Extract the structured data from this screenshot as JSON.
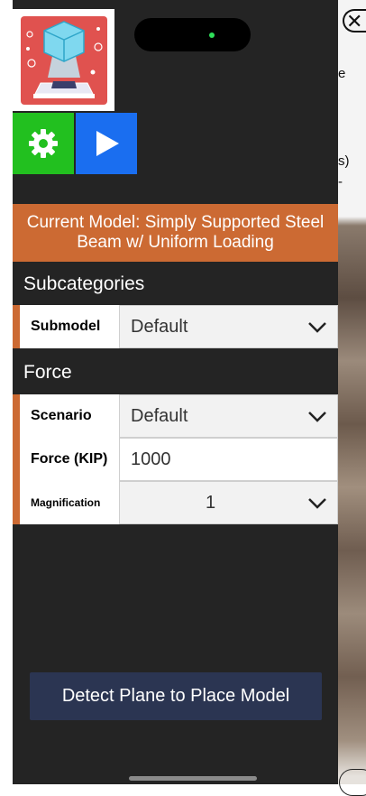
{
  "camera": {
    "text_e": "e",
    "text_s": "s)",
    "text_dot": "-"
  },
  "toolbar": {
    "settings_icon": "gear-icon",
    "play_icon": "play-icon"
  },
  "model": {
    "current_label": "Current Model: Simply Supported Steel Beam w/ Uniform Loading"
  },
  "subcategories": {
    "title": "Subcategories",
    "submodel_label": "Submodel",
    "submodel_value": "Default"
  },
  "force": {
    "title": "Force",
    "scenario_label": "Scenario",
    "scenario_value": "Default",
    "force_label": "Force (KIP)",
    "force_value": "1000",
    "magnification_label": "Magnification",
    "magnification_value": "1"
  },
  "actions": {
    "detect_label": "Detect Plane to Place Model"
  },
  "colors": {
    "accent": "#cc6a33",
    "panel": "#242424",
    "settings_green": "#22c01f",
    "play_blue": "#1a6ef0",
    "detect_button": "#2b3552"
  }
}
